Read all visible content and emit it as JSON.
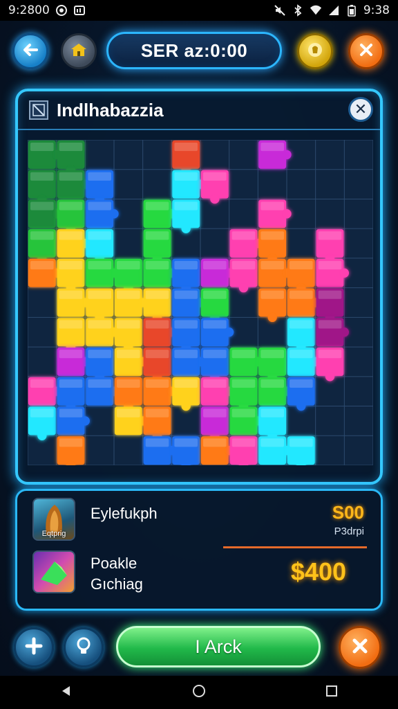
{
  "status_bar": {
    "time_left": "9:2800",
    "time_right": "9:38",
    "icons": [
      "whatsapp-icon",
      "gallery-icon",
      "mute-icon",
      "bluetooth-icon",
      "wifi-icon",
      "signal-icon",
      "battery-icon"
    ]
  },
  "topbar": {
    "back_icon": "arrow-left-icon",
    "home_icon": "home-icon",
    "timer_text": "SER az:0:00",
    "hint_icon": "gold-coin-icon",
    "close_icon": "close-icon"
  },
  "puzzle_panel": {
    "title": "Indlhabazzia",
    "close_icon": "close-icon",
    "board_rows": 11,
    "board_cols": 12,
    "pieces": [
      [
        "#1a8a3a",
        "#1a8a3a",
        "",
        "",
        "",
        "#e8472a",
        "",
        "",
        "#c82ad8",
        "",
        "",
        ""
      ],
      [
        "#1a8a3a",
        "#1a8a3a",
        "#1f6ef0",
        "",
        "",
        "#22e8ff",
        "#ff3fb0",
        "",
        "",
        "",
        "",
        ""
      ],
      [
        "#1a8a3a",
        "#26c43a",
        "#1f6ef0",
        "",
        "#26d940",
        "#22e8ff",
        "",
        "",
        "#ff3fb0",
        "",
        "",
        ""
      ],
      [
        "#26c43a",
        "#ffd21e",
        "#22e8ff",
        "",
        "#26d940",
        "",
        "",
        "#ff3fb0",
        "#ff7a12",
        "",
        "#ff3fb0",
        ""
      ],
      [
        "#ff7a12",
        "#ffd21e",
        "#26d940",
        "#26d940",
        "#26d940",
        "#1f6ef0",
        "#c82ad8",
        "#ff3fb0",
        "#ff7a12",
        "#ff7a12",
        "#ff3fb0",
        ""
      ],
      [
        "",
        "#ffd21e",
        "#ffd21e",
        "#ffd21e",
        "#ffd21e",
        "#1f6ef0",
        "#26d940",
        "",
        "#ff7a12",
        "#ff7a12",
        "#a01888",
        ""
      ],
      [
        "",
        "#ffd21e",
        "#ffd21e",
        "#ffd21e",
        "#e8472a",
        "#1f6ef0",
        "#1f6ef0",
        "",
        "",
        "#22e8ff",
        "#a01888",
        ""
      ],
      [
        "",
        "#c82ad8",
        "#1f6ef0",
        "#ffd21e",
        "#e8472a",
        "#1f6ef0",
        "#1f6ef0",
        "#26d940",
        "#26d940",
        "#22e8ff",
        "#ff3fb0",
        ""
      ],
      [
        "#ff3fb0",
        "#1f6ef0",
        "#1f6ef0",
        "#ff7a12",
        "#ff7a12",
        "#ffd21e",
        "#ff3fb0",
        "#26d940",
        "#26d940",
        "#1f6ef0",
        "",
        ""
      ],
      [
        "#22e8ff",
        "#1f6ef0",
        "",
        "#ffd21e",
        "#ff7a12",
        "",
        "#c82ad8",
        "#26d940",
        "#22e8ff",
        "",
        "",
        ""
      ],
      [
        "",
        "#ff7a12",
        "",
        "",
        "#1f6ef0",
        "#1f6ef0",
        "#ff7a12",
        "#ff3fb0",
        "#22e8ff",
        "#22e8ff",
        "",
        ""
      ]
    ]
  },
  "items": [
    {
      "thumb_label": "Eqtprig",
      "name": "Eylefukph",
      "price": "S00",
      "subtext": "P3drpi"
    },
    {
      "name_line1": "Poakle",
      "name_line2": "Gıchiag",
      "price": "$400"
    }
  ],
  "bottom_actions": {
    "plus_icon": "plus-icon",
    "hint_icon": "lightbulb-icon",
    "main_button_label": "I Arck",
    "close_icon": "close-icon"
  },
  "navbar": {
    "back_icon": "nav-back-icon",
    "home_icon": "nav-home-icon",
    "recents_icon": "nav-recents-icon"
  }
}
